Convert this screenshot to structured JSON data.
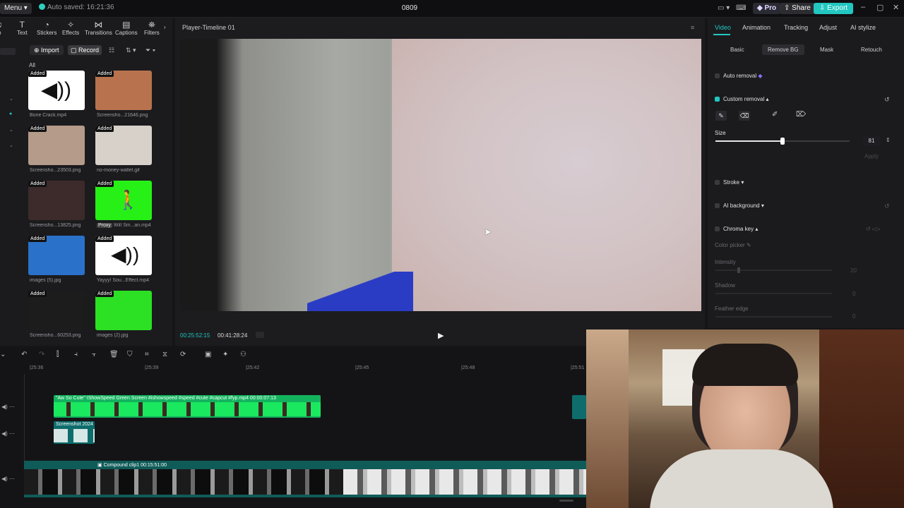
{
  "topbar": {
    "menu": "Menu",
    "autosave": "Auto saved: 16:21:36",
    "title": "0809",
    "pro": "Pro",
    "share": "Share",
    "export": "Export"
  },
  "tools": [
    "Text",
    "Stickers",
    "Effects",
    "Transitions",
    "Captions",
    "Filters"
  ],
  "media": {
    "import": "Import",
    "record": "Record",
    "filter_all": "All",
    "badge": "Added",
    "proxy": "Proxy",
    "items": [
      {
        "label": "Bone Crack.mp4",
        "color": "#ffffff"
      },
      {
        "label": "Screensho...21646.png",
        "color": "#b8734e"
      },
      {
        "label": "Screensho...23503.png",
        "color": "#b59b89"
      },
      {
        "label": "no-money-wallet.gif",
        "color": "#d7d1c9"
      },
      {
        "label": "Screensho...13825.png",
        "color": "#3c2b2a"
      },
      {
        "label": "Will Sm...an.mp4",
        "color": "#26f016"
      },
      {
        "label": "images (5).jpg",
        "color": "#2a71c9"
      },
      {
        "label": "Yayyy! Sou...Effect.mp4",
        "color": "#ffffff"
      },
      {
        "label": "Screensho...60253.png",
        "color": "#1c1c1c"
      },
      {
        "label": "images (2).jpg",
        "color": "#2ce024"
      }
    ]
  },
  "player": {
    "title": "Player-Timeline 01",
    "time_current": "00:25:52:15",
    "time_total": "00:41:28:24"
  },
  "right": {
    "tabs": [
      "Video",
      "Animation",
      "Tracking",
      "Adjust",
      "AI stylize"
    ],
    "subtabs": [
      "Basic",
      "Remove BG",
      "Mask",
      "Retouch"
    ],
    "auto_removal": "Auto removal",
    "custom_removal": "Custom removal",
    "size_label": "Size",
    "size_value": "81",
    "apply": "Apply",
    "stroke": "Stroke",
    "ai_background": "AI background",
    "chroma_key": "Chroma key",
    "color_picker": "Color picker",
    "intensity": "Intensity",
    "intensity_value": "20",
    "shadow": "Shadow",
    "shadow_value": "0",
    "feather_edge": "Feather edge",
    "feather_value": "0"
  },
  "timeline": {
    "ruler": [
      "|25:36",
      "|25:39",
      "|25:42",
      "|25:45",
      "|25:48",
      "|25:51"
    ],
    "clip1_label": "\"Aw So Cute\" IShowSpeed  Green Screen #ishowspeed #speed #cute #capcut #fyp.mp4  00:00:07:13",
    "clip2_label": "Screenshot 2024",
    "main_label": "Compound clip1  00:15:51:00"
  },
  "colors": {
    "accent": "#21c7c0",
    "panel": "#1b1b1e"
  }
}
